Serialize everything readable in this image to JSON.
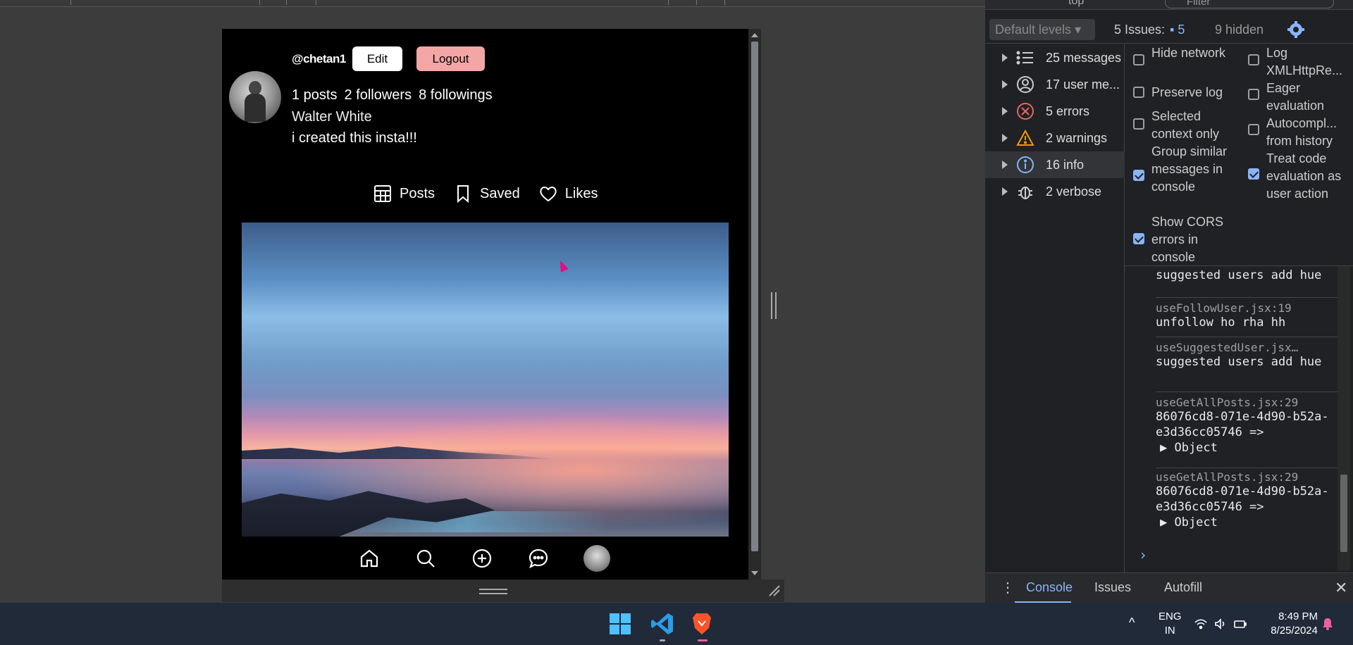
{
  "profile": {
    "username": "@chetan1",
    "edit_label": "Edit",
    "logout_label": "Logout",
    "posts_stat": "1 posts",
    "followers_stat": "2 followers",
    "followings_stat": "8 followings",
    "full_name": "Walter White",
    "bio": "i created this insta!!!"
  },
  "tabs": [
    {
      "label": "Posts",
      "icon": "grid-icon"
    },
    {
      "label": "Saved",
      "icon": "bookmark-icon"
    },
    {
      "label": "Likes",
      "icon": "heart-icon"
    }
  ],
  "bottom_nav": [
    "home-icon",
    "search-icon",
    "add-icon",
    "messages-icon",
    "avatar"
  ],
  "devtools": {
    "context": "top",
    "filter_placeholder": "Filter",
    "levels_label": "Default levels",
    "issues_label": "5 Issues:",
    "issues_count": "5",
    "hidden_label": "9 hidden",
    "sidebar": [
      {
        "label": "25 messages",
        "icon": "list-icon"
      },
      {
        "label": "17 user me...",
        "icon": "user-icon"
      },
      {
        "label": "5 errors",
        "icon": "error-icon"
      },
      {
        "label": "2 warnings",
        "icon": "warning-icon"
      },
      {
        "label": "16 info",
        "icon": "info-icon"
      },
      {
        "label": "2 verbose",
        "icon": "bug-icon"
      }
    ],
    "settings_left": [
      {
        "label": "Hide network",
        "checked": false
      },
      {
        "label": "Preserve log",
        "checked": false
      },
      {
        "label": "Selected context only",
        "checked": false
      },
      {
        "label": "Group similar messages in console",
        "checked": true
      },
      {
        "label": "Show CORS errors in console",
        "checked": true
      }
    ],
    "settings_right": [
      {
        "label": "Log XMLHttpRe...",
        "checked": false
      },
      {
        "label": "Eager evaluation",
        "checked": false
      },
      {
        "label": "Autocompl... from history",
        "checked": false
      },
      {
        "label": "Treat code evaluation as user action",
        "checked": true
      }
    ],
    "console_entries": [
      {
        "source": "",
        "message": "suggested users add hue"
      },
      {
        "source": "useFollowUser.jsx:19",
        "message": "unfollow ho rha hh"
      },
      {
        "source": "useSuggestedUser.jsx…",
        "message": "suggested users add hue"
      },
      {
        "source": "useGetAllPosts.jsx:29",
        "message": "86076cd8-071e-4d90-b52a-e3d36cc05746  =>",
        "object": "▶ Object"
      },
      {
        "source": "useGetAllPosts.jsx:29",
        "message": "86076cd8-071e-4d90-b52a-e3d36cc05746  =>",
        "object": "▶ Object"
      }
    ],
    "prompt": "›",
    "bottom_tabs": [
      "Console",
      "Issues",
      "Autofill"
    ],
    "accent": "#8ab4f8"
  },
  "taskbar": {
    "lang_line1": "ENG",
    "lang_line2": "IN",
    "time": "8:49 PM",
    "date": "8/25/2024"
  }
}
